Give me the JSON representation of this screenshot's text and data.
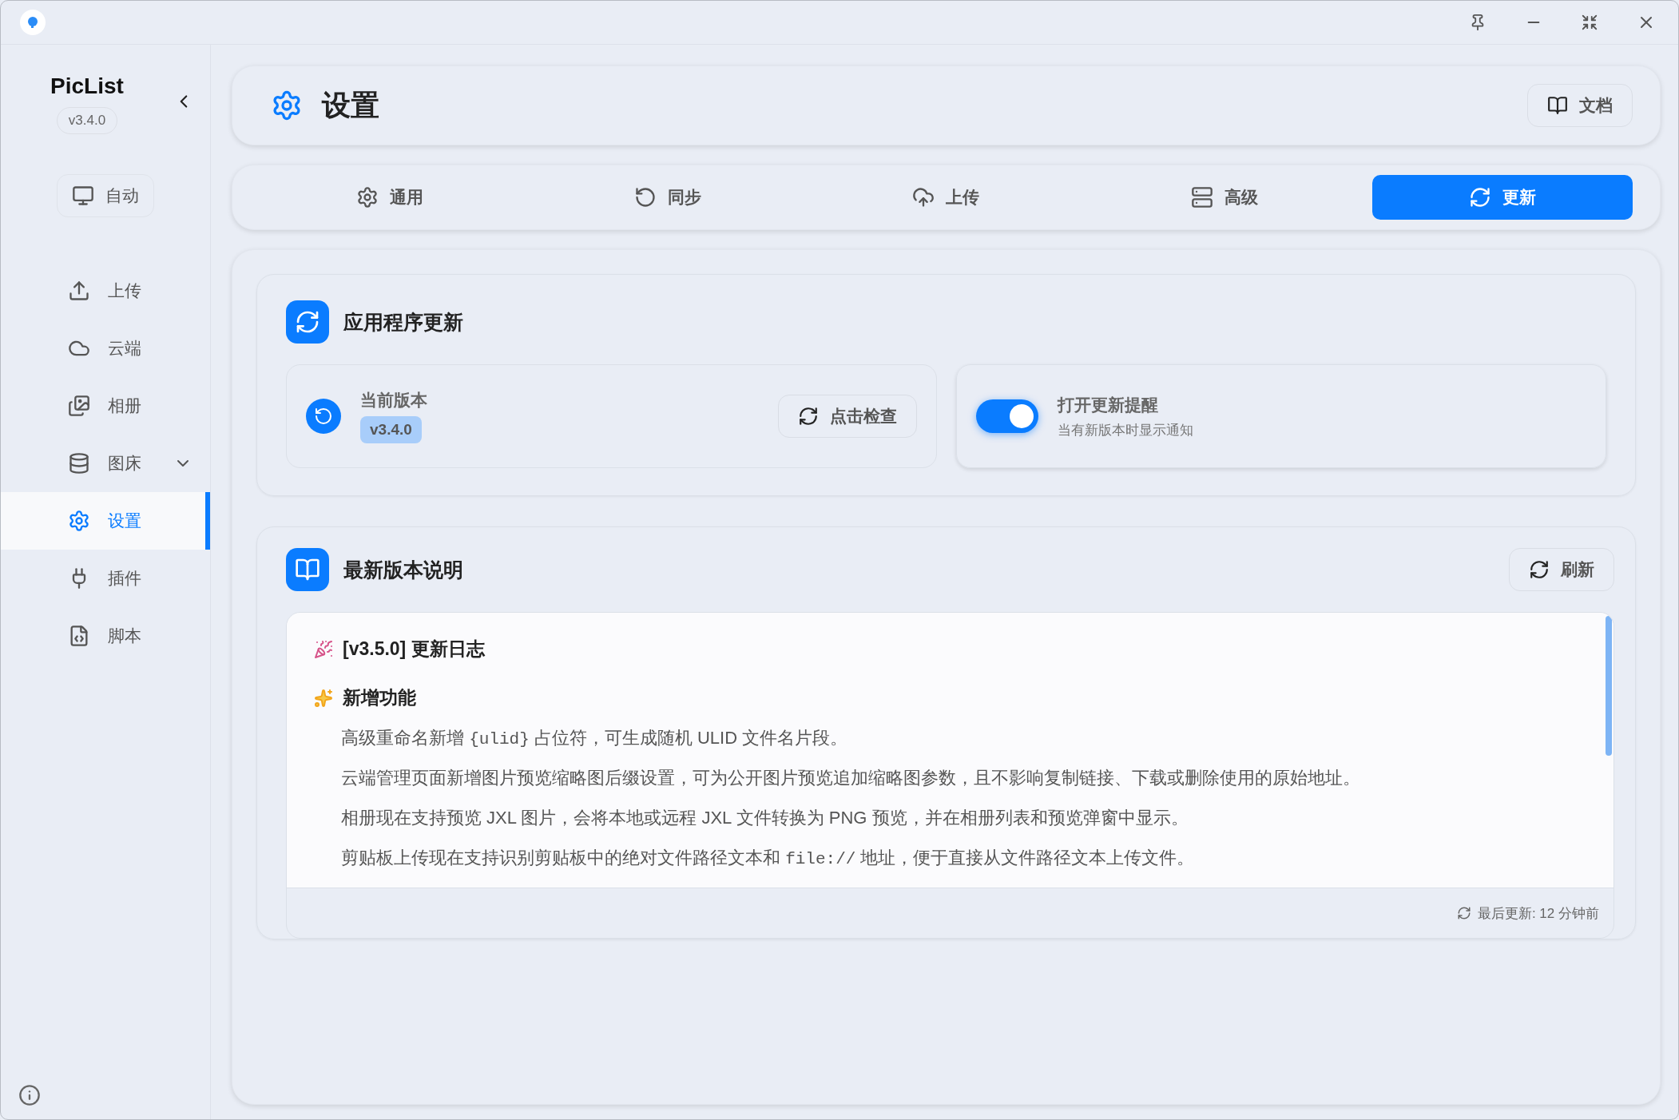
{
  "sidebar": {
    "app_name": "PicList",
    "version": "v3.4.0",
    "theme_button": "自动",
    "items": [
      {
        "label": "上传",
        "kind": "upload",
        "selected": false
      },
      {
        "label": "云端",
        "kind": "cloud",
        "selected": false
      },
      {
        "label": "相册",
        "kind": "album",
        "selected": false
      },
      {
        "label": "图床",
        "kind": "database",
        "selected": false,
        "expandable": true
      },
      {
        "label": "设置",
        "kind": "settings",
        "selected": true
      },
      {
        "label": "插件",
        "kind": "plug",
        "selected": false
      },
      {
        "label": "脚本",
        "kind": "script",
        "selected": false
      }
    ]
  },
  "header": {
    "title": "设置",
    "docs_button": "文档"
  },
  "tabs": [
    {
      "label": "通用",
      "kind": "settings",
      "selected": false
    },
    {
      "label": "同步",
      "kind": "sync",
      "selected": false
    },
    {
      "label": "上传",
      "kind": "upload",
      "selected": false
    },
    {
      "label": "高级",
      "kind": "server",
      "selected": false
    },
    {
      "label": "更新",
      "kind": "refresh",
      "selected": true
    }
  ],
  "app_update": {
    "title": "应用程序更新",
    "current_version_label": "当前版本",
    "current_version": "v3.4.0",
    "check_button": "点击检查",
    "reminder": {
      "label": "打开更新提醒",
      "description": "当有新版本时显示通知",
      "on": true
    }
  },
  "release_notes": {
    "title": "最新版本说明",
    "refresh_button": "刷新",
    "heading": "[v3.5.0] 更新日志",
    "section": "新增功能",
    "lines": [
      [
        {
          "kind": "text",
          "text": "高级重命名新增 "
        },
        {
          "kind": "code",
          "text": "{ulid}"
        },
        {
          "kind": "text",
          "text": " 占位符，可生成随机 ULID 文件名片段。"
        }
      ],
      [
        {
          "kind": "text",
          "text": "云端管理页面新增图片预览缩略图后缀设置，可为公开图片预览追加缩略图参数，且不影响复制链接、下载或删除使用的原始地址。"
        }
      ],
      [
        {
          "kind": "text",
          "text": "相册现在支持预览 JXL 图片，会将本地或远程 JXL 文件转换为 PNG 预览，并在相册列表和预览弹窗中显示。"
        }
      ],
      [
        {
          "kind": "text",
          "text": "剪贴板上传现在支持识别剪贴板中的绝对文件路径文本和 "
        },
        {
          "kind": "code",
          "text": "file://"
        },
        {
          "kind": "text",
          "text": " 地址，便于直接从文件路径文本上传文件。"
        }
      ]
    ],
    "last_updated": "最后更新: 12 分钟前"
  }
}
